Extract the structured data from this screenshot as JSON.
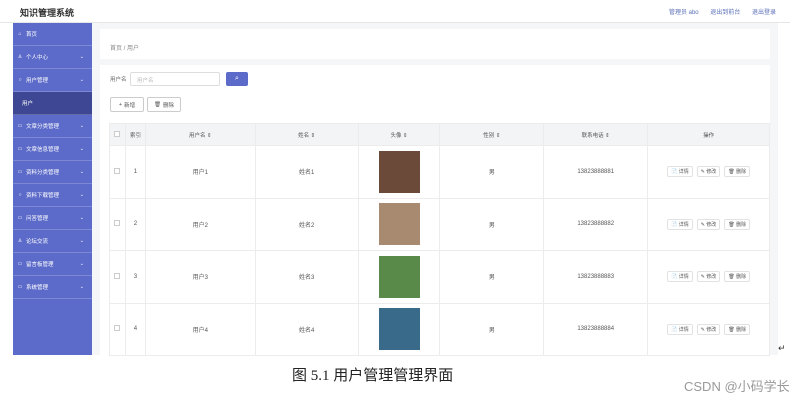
{
  "app": {
    "title": "知识管理系统"
  },
  "top_links": [
    "管理员 abo",
    "退出到前台",
    "退出登录"
  ],
  "sidebar": [
    {
      "label": "首页",
      "icon": "⌂",
      "chevron": false
    },
    {
      "label": "个人中心",
      "icon": "♙",
      "chevron": true
    },
    {
      "label": "用户管理",
      "icon": "○",
      "chevron": true
    },
    {
      "label": "用户",
      "icon": "",
      "chevron": false,
      "sub": true
    },
    {
      "label": "文章分类管理",
      "icon": "▭",
      "chevron": true
    },
    {
      "label": "文章信息管理",
      "icon": "▭",
      "chevron": true
    },
    {
      "label": "资料分类管理",
      "icon": "▭",
      "chevron": true
    },
    {
      "label": "资料下载管理",
      "icon": "○",
      "chevron": true
    },
    {
      "label": "问答管理",
      "icon": "▭",
      "chevron": true
    },
    {
      "label": "论坛交流",
      "icon": "♙",
      "chevron": true
    },
    {
      "label": "留言板管理",
      "icon": "▭",
      "chevron": true
    },
    {
      "label": "系统管理",
      "icon": "▭",
      "chevron": true
    }
  ],
  "breadcrumb": "首页 / 用户",
  "search": {
    "label": "用户名",
    "placeholder": "用户名",
    "button_icon": "⌕"
  },
  "actions": {
    "add": "新增",
    "delete": "删除"
  },
  "table": {
    "headers": [
      "",
      "索引",
      "用户名 ⇕",
      "姓名 ⇕",
      "头像 ⇕",
      "性别 ⇕",
      "联系电话 ⇕",
      "操作"
    ],
    "rows": [
      {
        "index": "1",
        "username": "用户1",
        "name": "姓名1",
        "gender": "男",
        "phone": "13823888881",
        "avatar_color": "#6b4a3a"
      },
      {
        "index": "2",
        "username": "用户2",
        "name": "姓名2",
        "gender": "男",
        "phone": "13823888882",
        "avatar_color": "#a88a70"
      },
      {
        "index": "3",
        "username": "用户3",
        "name": "姓名3",
        "gender": "男",
        "phone": "13823888883",
        "avatar_color": "#5a8a4a"
      },
      {
        "index": "4",
        "username": "用户4",
        "name": "姓名4",
        "gender": "男",
        "phone": "13823888884",
        "avatar_color": "#3a6a8a"
      }
    ],
    "row_ops": [
      "详情",
      "修改",
      "删除"
    ]
  },
  "caption": "图 5.1 用户管理管理界面",
  "watermark": "CSDN @小码学长"
}
